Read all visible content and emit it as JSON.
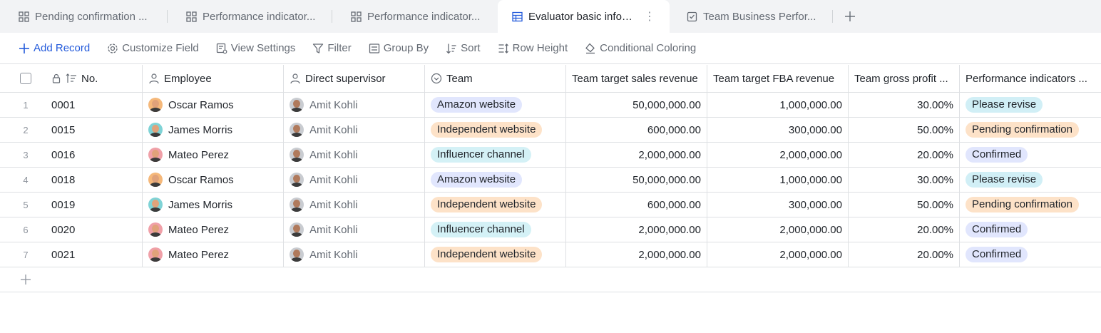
{
  "tabs": [
    {
      "label": "Pending confirmation ...",
      "icon": "grid-icon",
      "active": false
    },
    {
      "label": "Performance indicator...",
      "icon": "grid-icon",
      "active": false
    },
    {
      "label": "Performance indicator...",
      "icon": "grid-icon",
      "active": false
    },
    {
      "label": "Evaluator basic inform...",
      "icon": "table-icon",
      "active": true
    },
    {
      "label": "Team Business Perfor...",
      "icon": "checklist-icon",
      "active": false
    }
  ],
  "toolbar": {
    "add_record": "Add Record",
    "customize_field": "Customize Field",
    "view_settings": "View Settings",
    "filter": "Filter",
    "group_by": "Group By",
    "sort": "Sort",
    "row_height": "Row Height",
    "conditional_coloring": "Conditional Coloring"
  },
  "columns": {
    "no": "No.",
    "employee": "Employee",
    "supervisor": "Direct supervisor",
    "team": "Team",
    "sales": "Team target sales revenue",
    "fba": "Team target FBA revenue",
    "gross_profit": "Team gross profit ...",
    "performance": "Performance indicators ..."
  },
  "rows": [
    {
      "idx": "1",
      "no": "0001",
      "employee": "Oscar Ramos",
      "supervisor": "Amit Kohli",
      "team": "Amazon website",
      "sales": "50,000,000.00",
      "fba": "1,000,000.00",
      "gp": "30.00%",
      "perf": "Please revise"
    },
    {
      "idx": "2",
      "no": "0015",
      "employee": "James Morris",
      "supervisor": "Amit Kohli",
      "team": "Independent website",
      "sales": "600,000.00",
      "fba": "300,000.00",
      "gp": "50.00%",
      "perf": "Pending confirmation"
    },
    {
      "idx": "3",
      "no": "0016",
      "employee": "Mateo Perez",
      "supervisor": "Amit Kohli",
      "team": "Influencer channel",
      "sales": "2,000,000.00",
      "fba": "2,000,000.00",
      "gp": "20.00%",
      "perf": "Confirmed"
    },
    {
      "idx": "4",
      "no": "0018",
      "employee": "Oscar Ramos",
      "supervisor": "Amit Kohli",
      "team": "Amazon website",
      "sales": "50,000,000.00",
      "fba": "1,000,000.00",
      "gp": "30.00%",
      "perf": "Please revise"
    },
    {
      "idx": "5",
      "no": "0019",
      "employee": "James Morris",
      "supervisor": "Amit Kohli",
      "team": "Independent website",
      "sales": "600,000.00",
      "fba": "300,000.00",
      "gp": "50.00%",
      "perf": "Pending confirmation"
    },
    {
      "idx": "6",
      "no": "0020",
      "employee": "Mateo Perez",
      "supervisor": "Amit Kohli",
      "team": "Influencer channel",
      "sales": "2,000,000.00",
      "fba": "2,000,000.00",
      "gp": "20.00%",
      "perf": "Confirmed"
    },
    {
      "idx": "7",
      "no": "0021",
      "employee": "Mateo Perez",
      "supervisor": "Amit Kohli",
      "team": "Independent website",
      "sales": "2,000,000.00",
      "fba": "2,000,000.00",
      "gp": "20.00%",
      "perf": "Confirmed"
    }
  ],
  "colors": {
    "accent": "#245bdb",
    "tag_amazon": "#e1e6fd",
    "tag_independent": "#fde2c8",
    "tag_influencer": "#d4f1f6"
  }
}
